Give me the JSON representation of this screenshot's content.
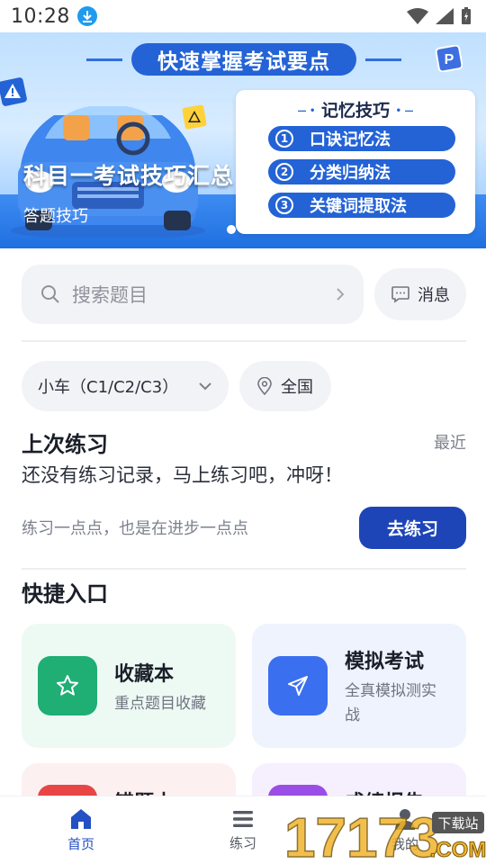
{
  "status_bar": {
    "time": "10:28"
  },
  "banner": {
    "pill": "快速掌握考试要点",
    "title": "科目一考试技巧汇总",
    "subtitle": "答题技巧",
    "card_title": "记忆技巧",
    "tips": [
      {
        "num": "1",
        "label": "口诀记忆法"
      },
      {
        "num": "2",
        "label": "分类归纳法"
      },
      {
        "num": "3",
        "label": "关键词提取法"
      }
    ]
  },
  "search": {
    "placeholder": "搜索题目"
  },
  "message_button": {
    "label": "消息"
  },
  "filters": {
    "vehicle": "小车（C1/C2/C3）",
    "region": "全国"
  },
  "last_practice": {
    "title": "上次练习",
    "recent": "最近",
    "empty": "还没有练习记录，马上练习吧，冲呀！",
    "motto": "练习一点点，也是在进步一点点",
    "go_button": "去练习"
  },
  "quick_entry": {
    "title": "快捷入口",
    "cards": [
      {
        "title": "收藏本",
        "desc": "重点题目收藏",
        "color": "#1fae74",
        "bg": "#edfaf4"
      },
      {
        "title": "模拟考试",
        "desc": "全真模拟测实战",
        "color": "#3a6ff0",
        "bg": "#eef3fe"
      },
      {
        "title": "错题本",
        "desc": "",
        "color": "#e84545",
        "bg": "#fdf0f0"
      },
      {
        "title": "成绩报告",
        "desc": "",
        "color": "#9a4ee6",
        "bg": "#f6effd"
      }
    ]
  },
  "bottom_nav": [
    {
      "label": "首页",
      "icon": "home-icon",
      "active": true
    },
    {
      "label": "练习",
      "icon": "list-icon",
      "active": false
    },
    {
      "label": "我的",
      "icon": "user-icon",
      "active": false
    }
  ],
  "watermark": {
    "number": "17173",
    "tag": "下载站",
    "domain": ".COM"
  },
  "colors": {
    "primary": "#1e45b8",
    "accent": "#2463d6",
    "banner_blue": "#1f6fe0"
  }
}
